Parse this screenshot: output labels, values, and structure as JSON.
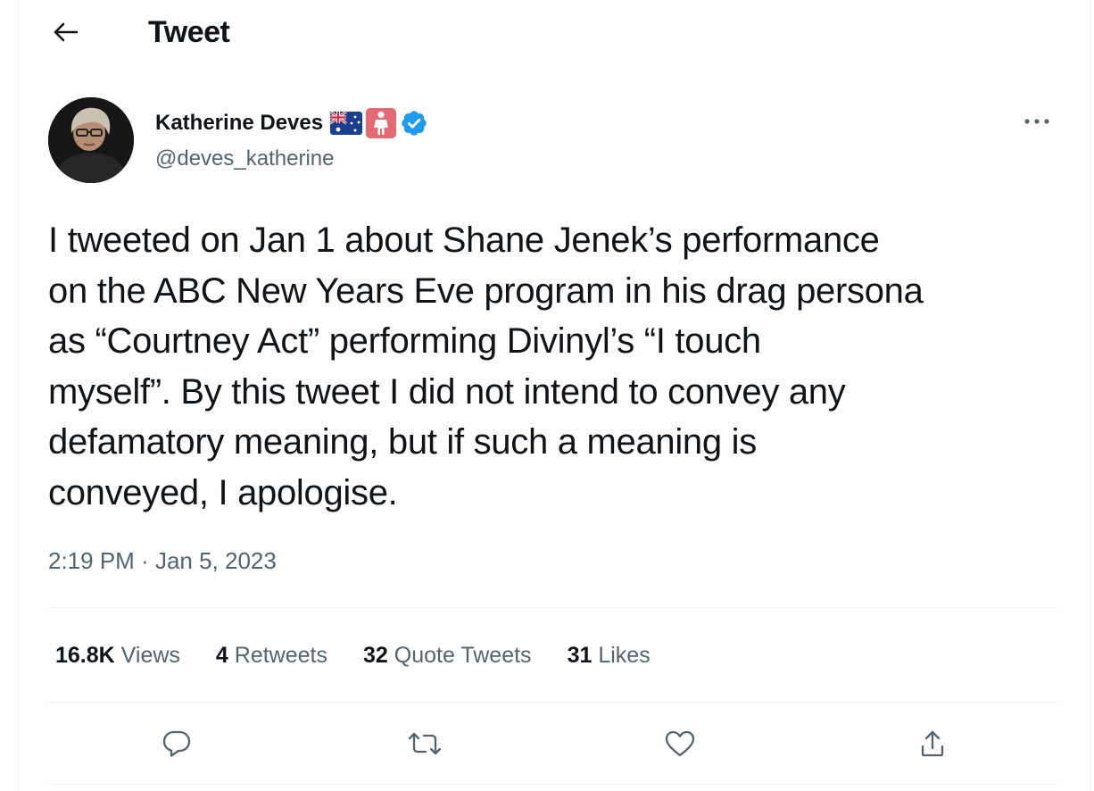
{
  "header": {
    "title": "Tweet"
  },
  "author": {
    "name": "Katherine Deves",
    "handle": "@deves_katherine"
  },
  "tweet": {
    "lines": [
      "I tweeted on Jan 1 about Shane Jenek’s performance",
      "on the ABC New Years Eve program in his drag persona",
      "as “Courtney Act” performing Divinyl’s “I touch",
      "myself”. By this tweet I did not intend to convey any",
      "defamatory meaning, but if such a meaning is",
      "conveyed, I apologise."
    ],
    "time": "2:19 PM",
    "separator": " · ",
    "date": "Jan 5, 2023"
  },
  "stats": {
    "views": {
      "count": "16.8K",
      "label": "Views"
    },
    "retweets": {
      "count": "4",
      "label": "Retweets"
    },
    "quotes": {
      "count": "32",
      "label": "Quote Tweets"
    },
    "likes": {
      "count": "31",
      "label": "Likes"
    }
  },
  "icons": {
    "back": "arrow-left-icon",
    "flag": "australia-flag-icon",
    "emoji": "standing-person-icon",
    "verified": "verified-badge-icon",
    "more": "more-dots-icon",
    "reply": "reply-icon",
    "retweet": "retweet-icon",
    "like": "heart-icon",
    "share": "share-icon"
  },
  "colors": {
    "text": "#0f1419",
    "secondary": "#536471",
    "verified": "#1d9bf0",
    "divider": "#eff3f4"
  }
}
